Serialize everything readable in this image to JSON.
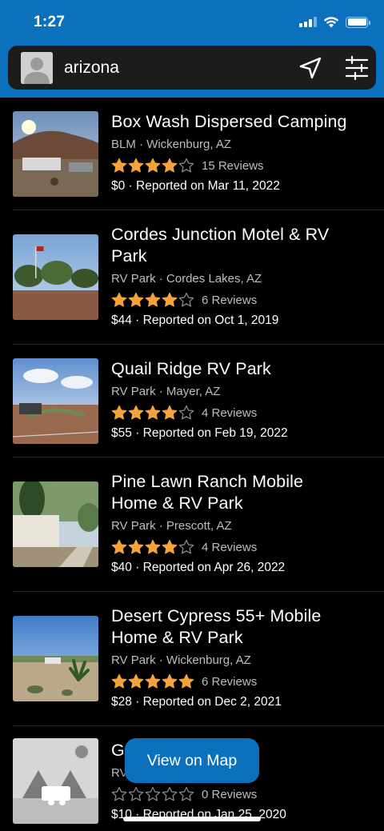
{
  "status_bar": {
    "time": "1:27"
  },
  "search": {
    "value": "arizona"
  },
  "listings": [
    {
      "name": "Box Wash Dispersed Camping",
      "type": "BLM",
      "location": "Wickenburg, AZ",
      "rating": 4,
      "reviews": "15 Reviews",
      "price": "$0",
      "reported": "Reported on Mar 11, 2022"
    },
    {
      "name": "Cordes Junction Motel & RV Park",
      "type": "RV Park",
      "location": "Cordes Lakes, AZ",
      "rating": 4,
      "reviews": "6 Reviews",
      "price": "$44",
      "reported": "Reported on Oct 1, 2019"
    },
    {
      "name": "Quail Ridge RV Park",
      "type": "RV Park",
      "location": "Mayer, AZ",
      "rating": 4,
      "reviews": "4 Reviews",
      "price": "$55",
      "reported": "Reported on Feb 19, 2022"
    },
    {
      "name": "Pine Lawn Ranch Mobile Home & RV Park",
      "type": "RV Park",
      "location": "Prescott, AZ",
      "rating": 4,
      "reviews": "4 Reviews",
      "price": "$40",
      "reported": "Reported on Apr 26, 2022"
    },
    {
      "name": "Desert Cypress 55+ Mobile Home & RV Park",
      "type": "RV Park",
      "location": "Wickenburg, AZ",
      "rating": 5,
      "reviews": "6 Reviews",
      "price": "$28",
      "reported": "Reported on Dec 2, 2021"
    },
    {
      "name": "G",
      "type": "RV",
      "location": "",
      "rating": 0,
      "reviews": "0 Reviews",
      "price": "$10",
      "reported": "Reported on Jan 25, 2020"
    }
  ],
  "separator": " · ",
  "map_button": "View on Map",
  "colors": {
    "accent": "#0b71bd",
    "star": "#f4a339"
  }
}
